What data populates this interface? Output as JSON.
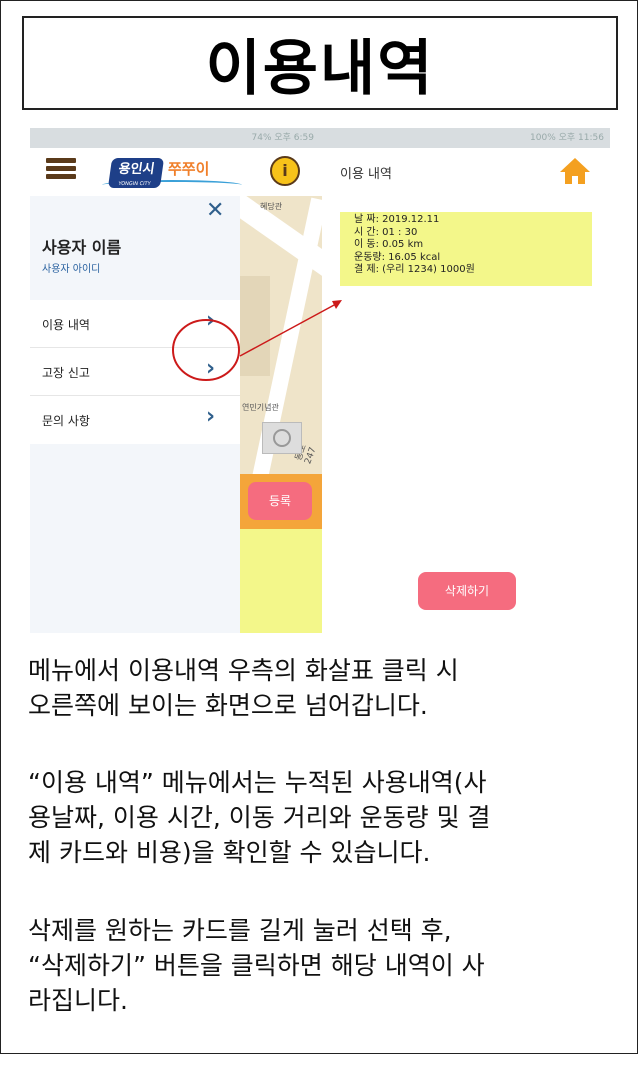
{
  "page_title": "이용내역",
  "left_phone": {
    "status": "74% 오후 6:59",
    "map_labels": [
      "혜당관",
      "연민기념관",
      "동로247"
    ],
    "drawer": {
      "user_name": "사용자 이름",
      "user_id": "사용자 아이디",
      "items": [
        {
          "label": "이용 내역"
        },
        {
          "label": "고장 신고"
        },
        {
          "label": "문의 사항"
        }
      ]
    },
    "logo_text": "용인시",
    "logo_sub": "YONGIN CITY",
    "brand_text": "쭈쭈이",
    "info_glyph": "i",
    "register_label": "등록"
  },
  "right_phone": {
    "status": "100% 오후 11:56",
    "title": "이용 내역",
    "record": {
      "date": "날  짜: 2019.12.11",
      "time": "시  간: 01 : 30",
      "distance": "이  동: 0.05 km",
      "exercise": "운동량: 16.05 kcal",
      "payment": "결  제: (우리 1234) 1000원"
    },
    "delete_label": "삭제하기"
  },
  "description": {
    "para1": [
      "메뉴에서 이용내역 우측의 화살표 클릭 시",
      "오른쪽에 보이는 화면으로 넘어갑니다."
    ],
    "para2": [
      "“이용 내역” 메뉴에서는 누적된 사용내역(사",
      "용날짜, 이용 시간, 이동 거리와 운동량 및 결",
      "제 카드와 비용)을 확인할 수 있습니다."
    ],
    "para3": [
      "삭제를 원하는 카드를 길게 눌러 선택 후,",
      "“삭제하기” 버튼을 클릭하면 해당 내역이 사",
      "라집니다."
    ]
  },
  "colors": {
    "accent_pink": "#f56c7f",
    "record_yellow": "#f3f78a",
    "annotation_red": "#cc1a1a",
    "icon_blue": "#2f5f8c"
  }
}
